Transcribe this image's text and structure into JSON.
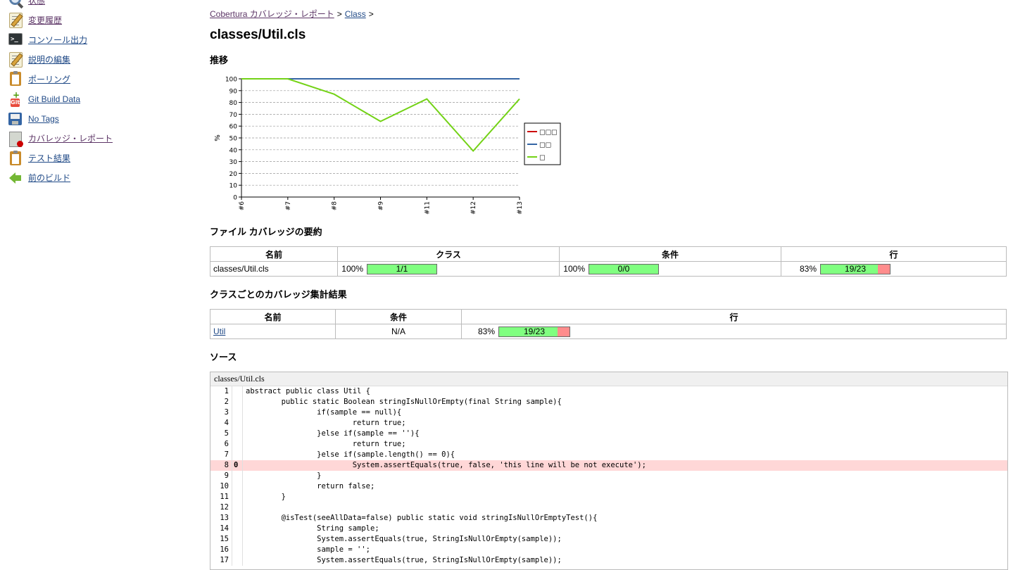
{
  "sidebar": {
    "items": [
      {
        "label": "状態",
        "icon": "magnifier-icon",
        "visited": true
      },
      {
        "label": "変更履歴",
        "icon": "notepad-icon",
        "visited": true
      },
      {
        "label": "コンソール出力",
        "icon": "terminal-icon",
        "visited": false
      },
      {
        "label": "説明の編集",
        "icon": "notepad-icon",
        "visited": false
      },
      {
        "label": "ポーリング",
        "icon": "clipboard-icon",
        "visited": false
      },
      {
        "label": "Git Build Data",
        "icon": "git-icon",
        "visited": false
      },
      {
        "label": "No Tags",
        "icon": "disk-icon",
        "visited": false
      },
      {
        "label": "カバレッジ・レポート",
        "icon": "report-icon",
        "visited": true
      },
      {
        "label": "テスト結果",
        "icon": "clipboard-icon",
        "visited": false
      },
      {
        "label": "前のビルド",
        "icon": "back-arrow-icon",
        "visited": false
      }
    ]
  },
  "breadcrumb": {
    "root": "Cobertura カバレッジ・レポート",
    "sep1": ">",
    "class_link": "Class",
    "sep2": ">"
  },
  "page_title": "classes/Util.cls",
  "sections": {
    "trend": "推移",
    "file_summary": "ファイル カバレッジの要約",
    "per_class": "クラスごとのカバレッジ集計結果",
    "source": "ソース"
  },
  "chart_data": {
    "type": "line",
    "categories": [
      "#6",
      "#7",
      "#8",
      "#9",
      "#11",
      "#12",
      "#13"
    ],
    "series": [
      {
        "name": "□□□",
        "color": "#cc0000",
        "values": [
          100,
          100,
          100,
          100,
          100,
          100,
          100
        ]
      },
      {
        "name": "□□",
        "color": "#3465a4",
        "values": [
          100,
          100,
          100,
          100,
          100,
          100,
          100
        ]
      },
      {
        "name": "□",
        "color": "#73d216",
        "values": [
          100,
          100,
          87,
          64,
          83,
          39,
          83
        ]
      }
    ],
    "ylabel": "%",
    "ylim": [
      0,
      100
    ],
    "yticks": [
      "0",
      "10",
      "20",
      "30",
      "40",
      "50",
      "60",
      "70",
      "80",
      "90",
      "100"
    ],
    "grid": true,
    "legend": "right"
  },
  "file_table": {
    "headers": [
      "名前",
      "クラス",
      "条件",
      "行"
    ],
    "row": {
      "name": "classes/Util.cls",
      "class_pct": "100%",
      "class_ratio": "1/1",
      "class_frac": 1.0,
      "cond_pct": "100%",
      "cond_ratio": "0/0",
      "cond_frac": 1.0,
      "line_pct": "83%",
      "line_ratio": "19/23",
      "line_frac": 0.826
    }
  },
  "class_table": {
    "headers": [
      "名前",
      "条件",
      "行"
    ],
    "row": {
      "name": "Util",
      "cond": "N/A",
      "line_pct": "83%",
      "line_ratio": "19/23",
      "line_frac": 0.826
    }
  },
  "source": {
    "file": "classes/Util.cls",
    "lines": [
      {
        "n": "1",
        "hits": "",
        "code": "abstract public class Util {",
        "miss": false
      },
      {
        "n": "2",
        "hits": "",
        "code": "        public static Boolean stringIsNullOrEmpty(final String sample){",
        "miss": false
      },
      {
        "n": "3",
        "hits": "",
        "code": "                if(sample == null){",
        "miss": false
      },
      {
        "n": "4",
        "hits": "",
        "code": "                        return true;",
        "miss": false
      },
      {
        "n": "5",
        "hits": "",
        "code": "                }else if(sample == ''){",
        "miss": false
      },
      {
        "n": "6",
        "hits": "",
        "code": "                        return true;",
        "miss": false
      },
      {
        "n": "7",
        "hits": "",
        "code": "                }else if(sample.length() == 0){",
        "miss": false
      },
      {
        "n": "8",
        "hits": "0",
        "code": "                        System.assertEquals(true, false, 'this line will be not execute');",
        "miss": true
      },
      {
        "n": "9",
        "hits": "",
        "code": "                }",
        "miss": false
      },
      {
        "n": "10",
        "hits": "",
        "code": "                return false;",
        "miss": false
      },
      {
        "n": "11",
        "hits": "",
        "code": "        }",
        "miss": false
      },
      {
        "n": "12",
        "hits": "",
        "code": "",
        "miss": false
      },
      {
        "n": "13",
        "hits": "",
        "code": "        @isTest(seeAllData=false) public static void stringIsNullOrEmptyTest(){",
        "miss": false
      },
      {
        "n": "14",
        "hits": "",
        "code": "                String sample;",
        "miss": false
      },
      {
        "n": "15",
        "hits": "",
        "code": "                System.assertEquals(true, StringIsNullOrEmpty(sample));",
        "miss": false
      },
      {
        "n": "16",
        "hits": "",
        "code": "                sample = '';",
        "miss": false
      },
      {
        "n": "17",
        "hits": "",
        "code": "                System.assertEquals(true, StringIsNullOrEmpty(sample));",
        "miss": false
      }
    ]
  }
}
